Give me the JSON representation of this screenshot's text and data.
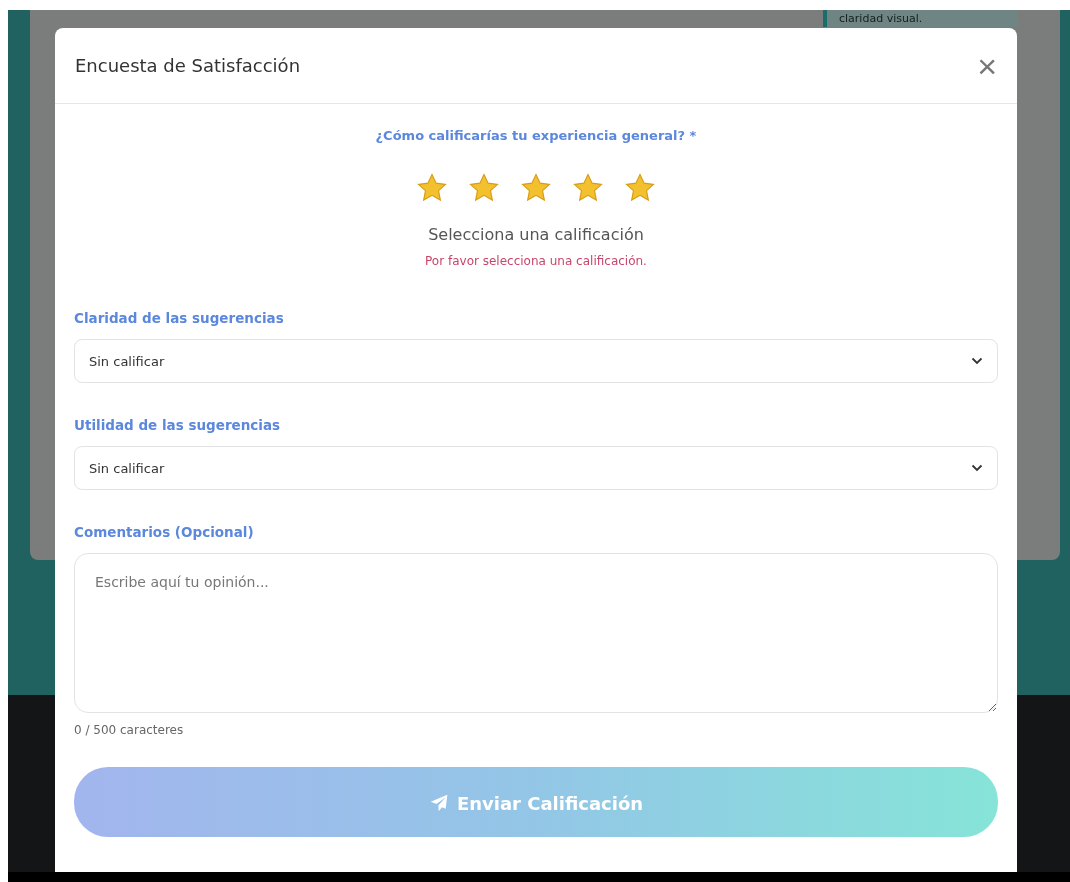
{
  "background": {
    "note_text": "claridad visual."
  },
  "modal": {
    "title": "Encuesta de Satisfacción",
    "close_icon": "×",
    "rating": {
      "question": "¿Cómo calificarías tu experiencia general? *",
      "stars": 5,
      "status": "Selecciona una calificación",
      "error": "Por favor selecciona una calificación."
    },
    "selects": [
      {
        "label": "Claridad de las sugerencias",
        "value": "Sin calificar"
      },
      {
        "label": "Utilidad de las sugerencias",
        "value": "Sin calificar"
      }
    ],
    "comments": {
      "label": "Comentarios (Opcional)",
      "placeholder": "Escribe aquí tu opinión...",
      "counter": "0 / 500 caracteres"
    },
    "submit": {
      "label": "Enviar Calificación",
      "disabled": true
    }
  }
}
